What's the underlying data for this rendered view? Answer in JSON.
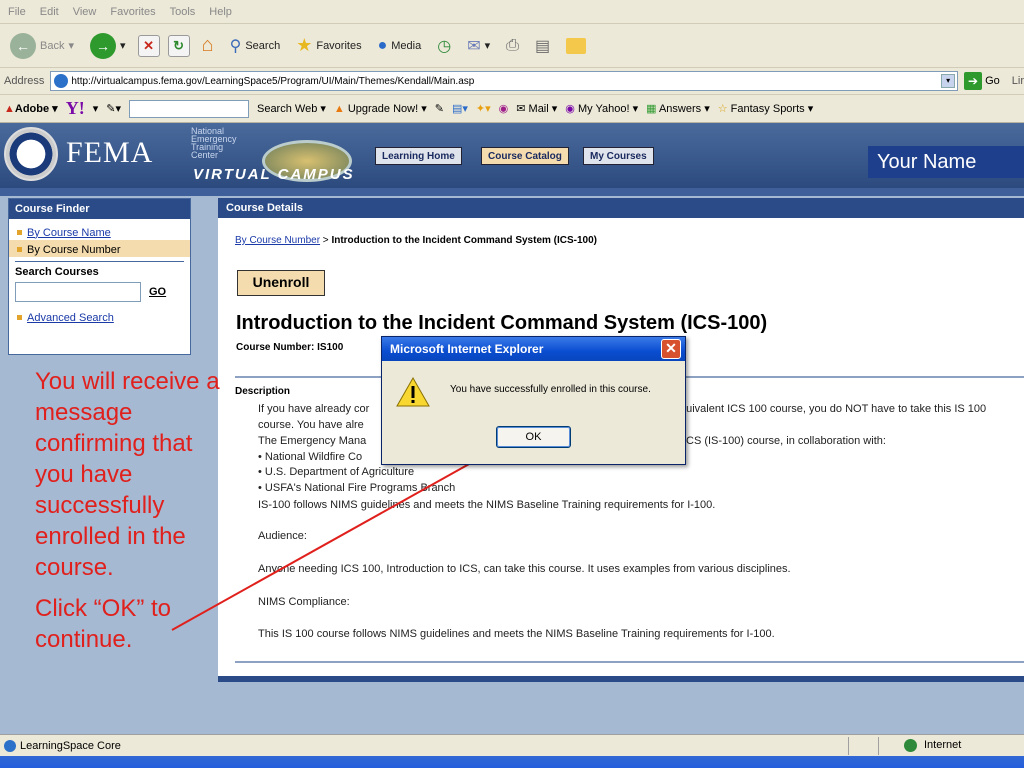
{
  "menu": [
    "File",
    "Edit",
    "View",
    "Favorites",
    "Tools",
    "Help"
  ],
  "toolbar": {
    "back": "Back",
    "search": "Search",
    "favorites": "Favorites",
    "media": "Media"
  },
  "address": {
    "label": "Address",
    "url": "http://virtualcampus.fema.gov/LearningSpace5/Program/UI/Main/Themes/Kendall/Main.asp",
    "go": "Go",
    "links": "Lir"
  },
  "yahoo": {
    "adobe": "Adobe",
    "search_web": "Search Web",
    "upgrade": "Upgrade Now!",
    "mail": "Mail",
    "my_yahoo": "My Yahoo!",
    "answers": "Answers",
    "fantasy": "Fantasy Sports"
  },
  "header": {
    "fema": "FEMA",
    "network": [
      "National",
      "Emergency",
      "Training",
      "Center"
    ],
    "virtual_campus": "VIRTUAL CAMPUS",
    "tabs": [
      "Learning Home",
      "Course Catalog",
      "My Courses"
    ],
    "user": "Your Name"
  },
  "finder": {
    "title": "Course Finder",
    "by_name": "By Course Name",
    "by_number": "By Course Number",
    "search_label": "Search Courses",
    "go": "GO",
    "advanced": "Advanced Search"
  },
  "content": {
    "title": "Course Details",
    "breadcrumb_link": "By Course Number",
    "breadcrumb_sep": " > ",
    "breadcrumb_current": "Introduction to the Incident Command System (ICS-100)",
    "unenroll": "Unenroll",
    "heading": "Introduction to the Incident Command System (ICS-100)",
    "course_number": "Course Number: IS100",
    "description_label": "Description",
    "lines": [
      "If you have already cor",
      "course. You have alre",
      "The Emergency Mana",
      "• National Wildfire Co",
      "• U.S. Department of Agriculture",
      "• USFA's National Fire Programs Branch",
      "IS-100 follows NIMS guidelines and meets the NIMS Baseline Training requirements for I-100.",
      "Audience:",
      "Anyone needing ICS 100, Introduction to ICS, can take this course. It uses examples from various disciplines.",
      "NIMS Compliance:",
      "This IS 100 course follows NIMS guidelines and meets the NIMS Baseline Training requirements for I-100."
    ],
    "right_line1": "quivalent ICS 100 course, you do NOT have to take this IS 100",
    "right_line3": "CS (IS-100) course, in collaboration with:"
  },
  "dialog": {
    "title": "Microsoft Internet Explorer",
    "message": "You have successfully enrolled in this course.",
    "ok": "OK"
  },
  "annotation": {
    "text1": "You will receive a message confirming that you have successfully enrolled in the course.",
    "text2": "Click “OK” to continue."
  },
  "status": {
    "left": "LearningSpace Core",
    "zone": "Internet"
  }
}
